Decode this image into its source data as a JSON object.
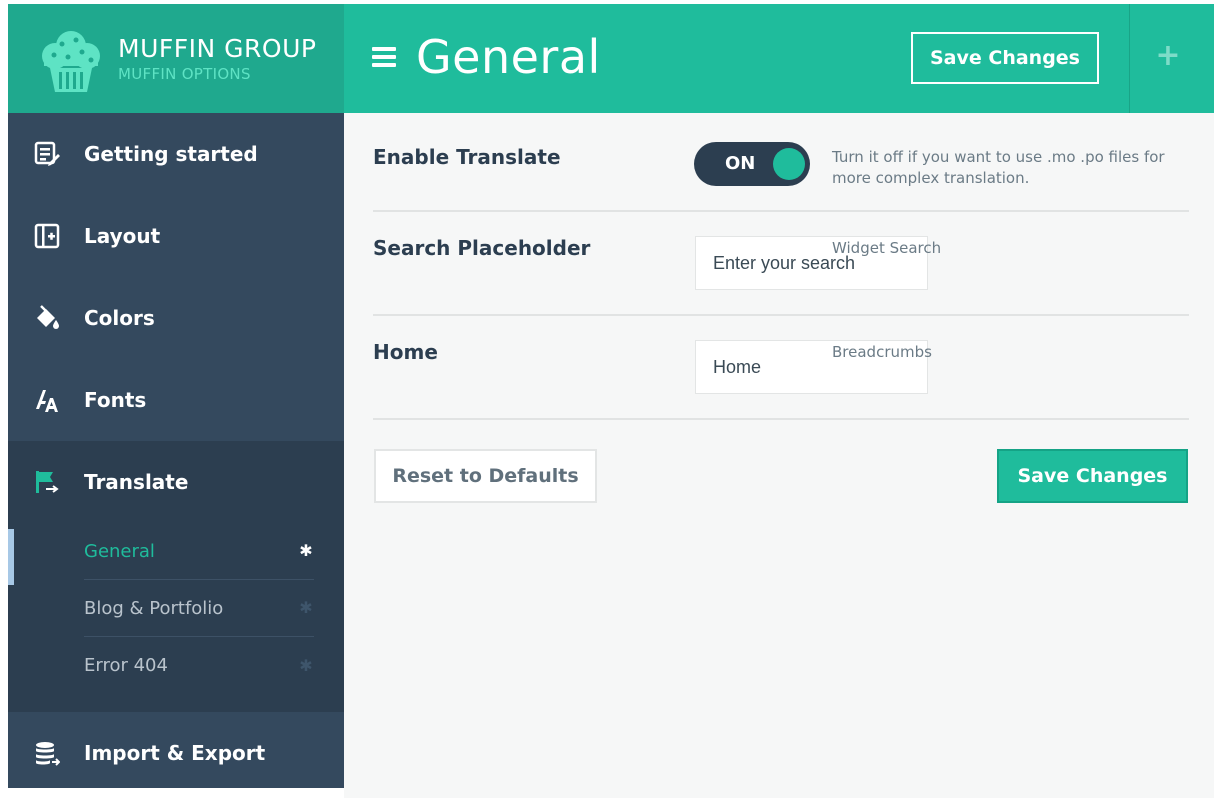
{
  "brand": {
    "title": "MUFFIN GROUP",
    "subtitle": "MUFFIN OPTIONS",
    "logo_icon": "muffin-icon"
  },
  "header": {
    "title": "General",
    "menu_icon": "hamburger-icon",
    "save_label": "Save Changes",
    "add_icon": "+"
  },
  "sidebar": {
    "items": [
      {
        "label": "Getting started",
        "icon": "edit-note-icon"
      },
      {
        "label": "Layout",
        "icon": "layout-icon"
      },
      {
        "label": "Colors",
        "icon": "paint-bucket-icon"
      },
      {
        "label": "Fonts",
        "icon": "font-icon"
      },
      {
        "label": "Translate",
        "icon": "flag-icon",
        "active": true
      },
      {
        "label": "Import & Export",
        "icon": "database-icon"
      }
    ],
    "subitems": [
      {
        "label": "General",
        "active": true,
        "icon": "gear-icon"
      },
      {
        "label": "Blog & Portfolio",
        "icon": "gear-icon"
      },
      {
        "label": "Error 404",
        "icon": "gear-icon"
      }
    ]
  },
  "settings": {
    "enable_translate": {
      "label": "Enable Translate",
      "toggle_text": "ON",
      "desc": "Turn it off if you want to use .mo .po files for more complex translation."
    },
    "search_placeholder": {
      "label": "Search Placeholder",
      "value": "Enter your search",
      "desc": "Widget Search"
    },
    "home": {
      "label": "Home",
      "value": "Home",
      "desc": "Breadcrumbs"
    }
  },
  "actions": {
    "reset_label": "Reset to Defaults",
    "save_label": "Save Changes"
  },
  "colors": {
    "accent": "#1fbc9c",
    "accent_dark": "#1fa98e",
    "sidebar": "#34495e",
    "sidebar_active": "#2c3e50",
    "content_bg": "#f6f7f7"
  }
}
